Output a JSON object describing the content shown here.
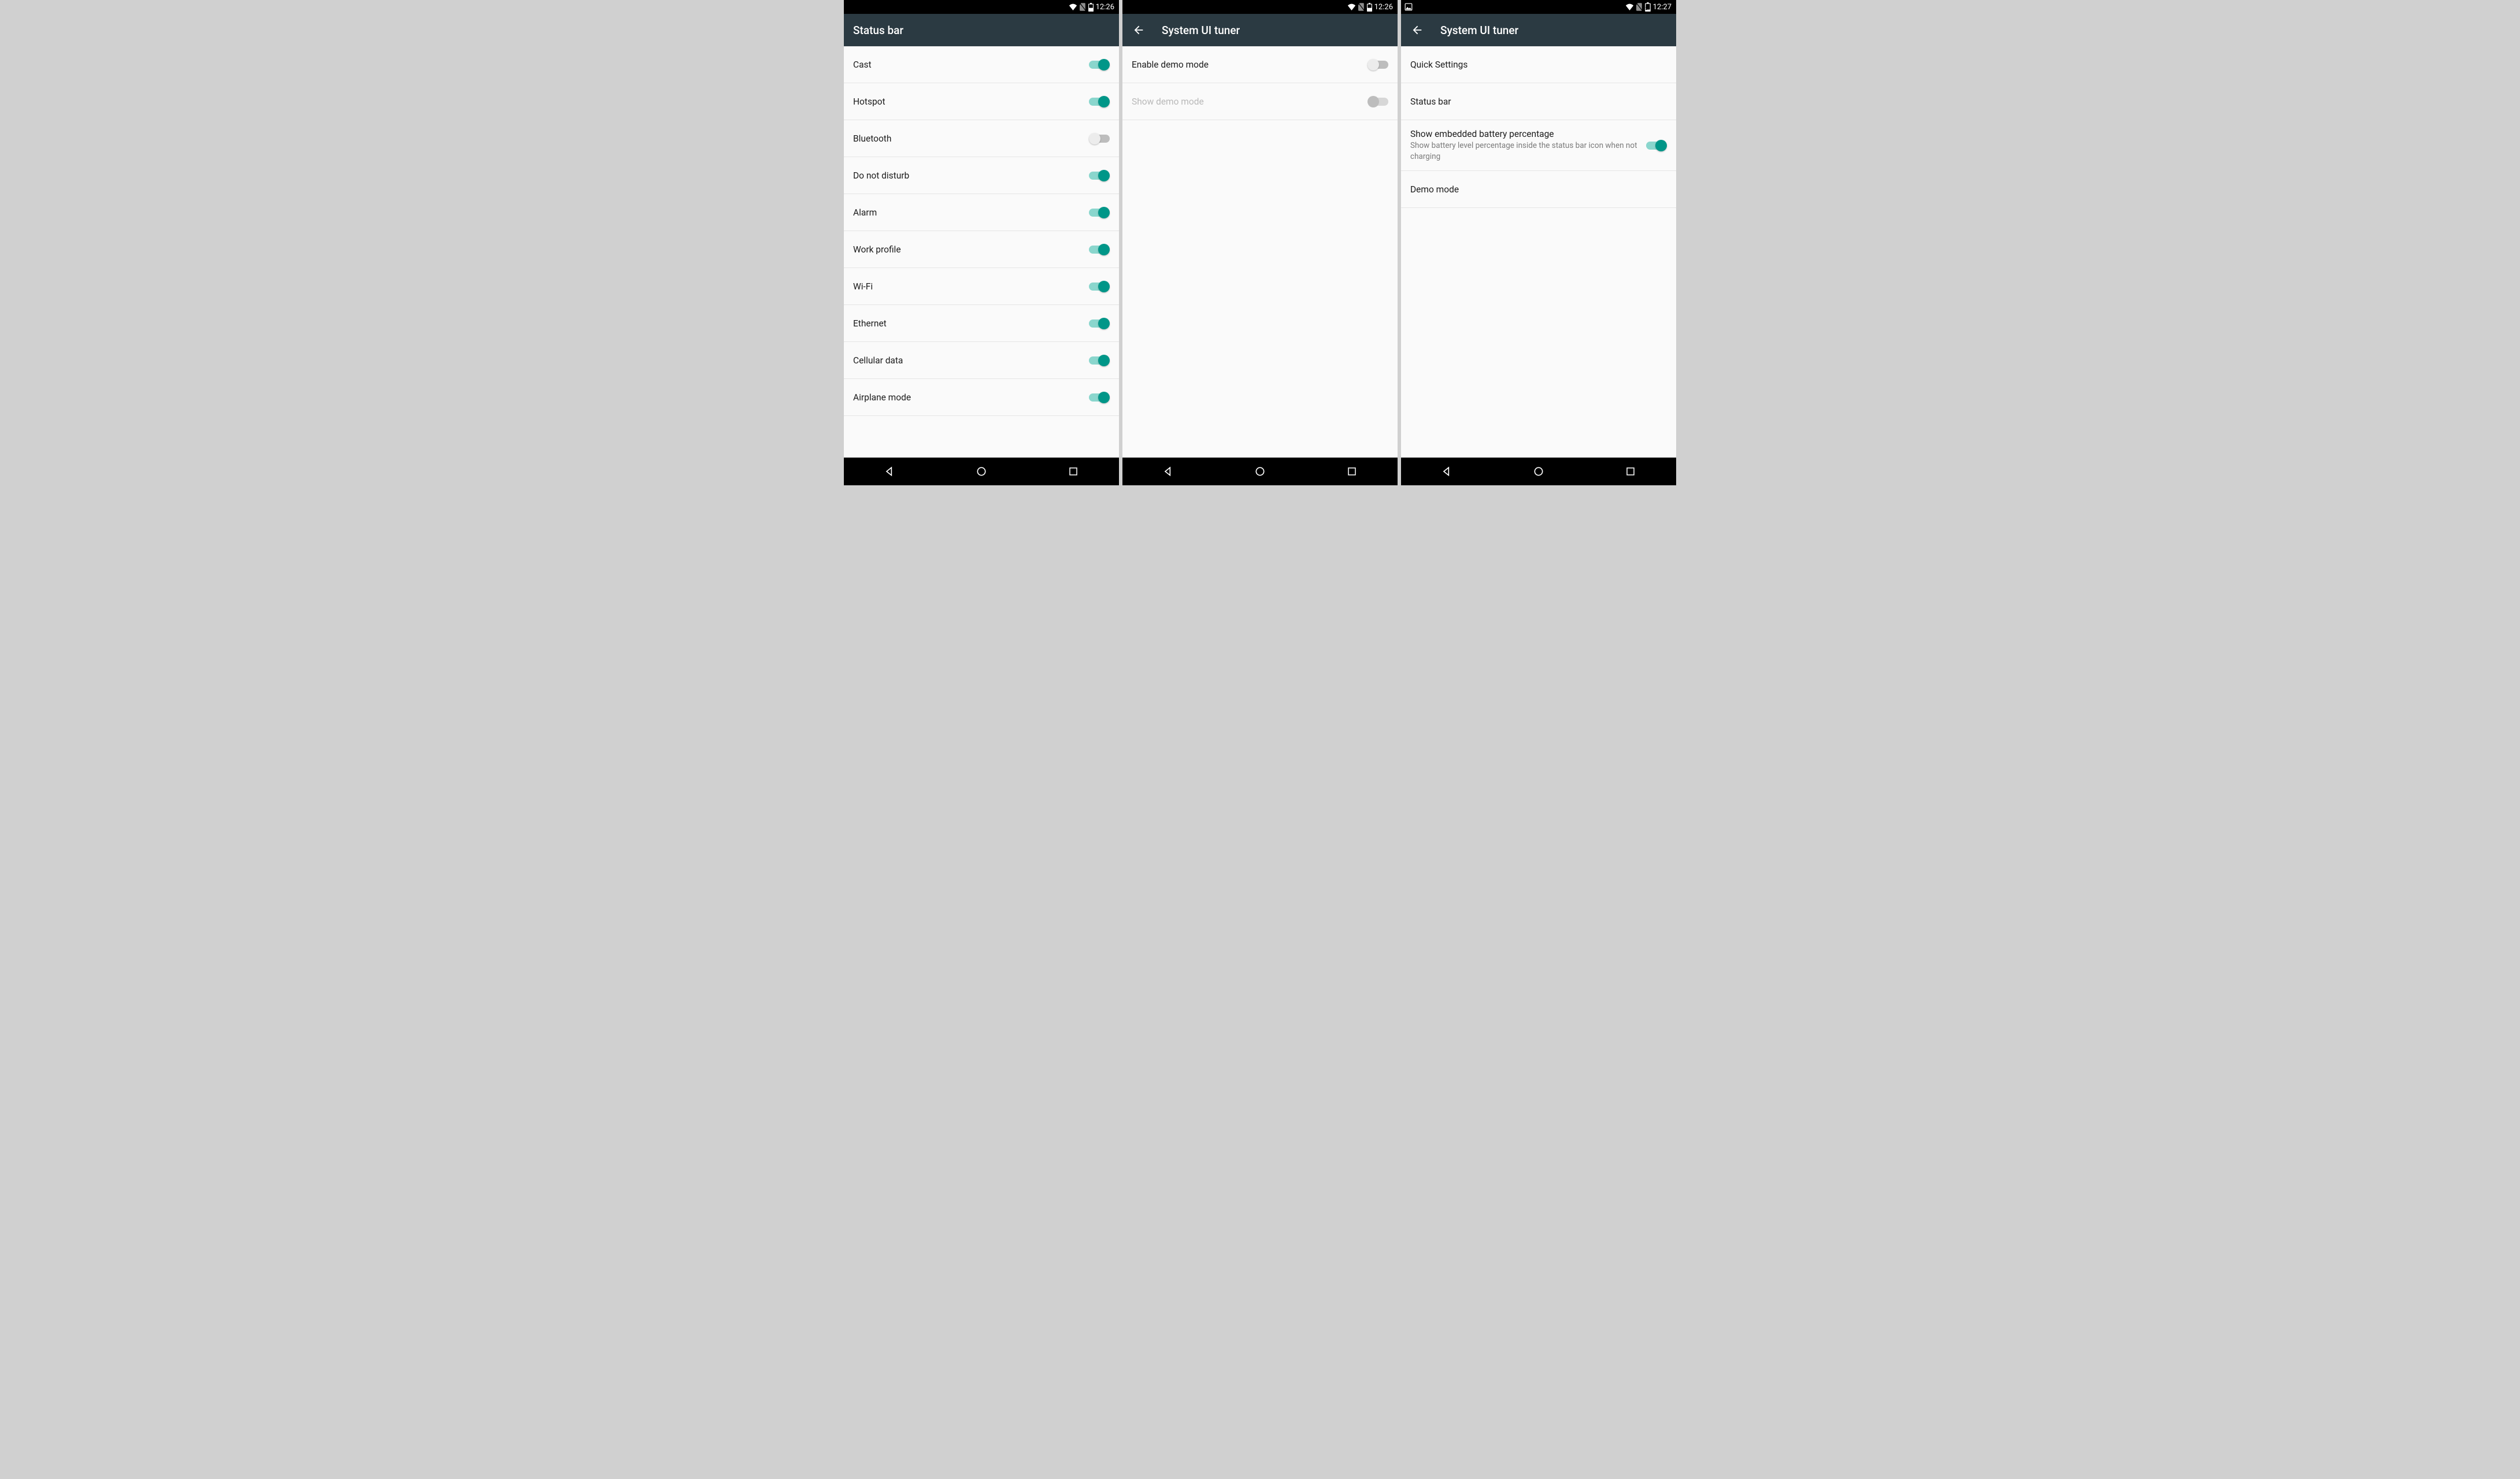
{
  "colors": {
    "accent": "#009688",
    "appbar": "#2b3a42"
  },
  "screens": [
    {
      "statusbar": {
        "time": "12:26",
        "leftIcons": [],
        "rightIcons": [
          "wifi",
          "no-sim",
          "battery"
        ]
      },
      "appbar": {
        "back": false,
        "title": "Status bar"
      },
      "rows": [
        {
          "name": "cast",
          "label": "Cast",
          "switch": "on"
        },
        {
          "name": "hotspot",
          "label": "Hotspot",
          "switch": "on"
        },
        {
          "name": "bluetooth",
          "label": "Bluetooth",
          "switch": "off"
        },
        {
          "name": "dnd",
          "label": "Do not disturb",
          "switch": "on"
        },
        {
          "name": "alarm",
          "label": "Alarm",
          "switch": "on"
        },
        {
          "name": "work-profile",
          "label": "Work profile",
          "switch": "on"
        },
        {
          "name": "wifi",
          "label": "Wi-Fi",
          "switch": "on"
        },
        {
          "name": "ethernet",
          "label": "Ethernet",
          "switch": "on"
        },
        {
          "name": "cellular-data",
          "label": "Cellular data",
          "switch": "on"
        },
        {
          "name": "airplane-mode",
          "label": "Airplane mode",
          "switch": "on"
        }
      ]
    },
    {
      "statusbar": {
        "time": "12:26",
        "leftIcons": [],
        "rightIcons": [
          "wifi",
          "no-sim",
          "battery"
        ]
      },
      "appbar": {
        "back": true,
        "title": "System UI tuner"
      },
      "rows": [
        {
          "name": "enable-demo-mode",
          "label": "Enable demo mode",
          "switch": "off"
        },
        {
          "name": "show-demo-mode",
          "label": "Show demo mode",
          "switch": "off-disabled",
          "disabled": true
        }
      ]
    },
    {
      "statusbar": {
        "time": "12:27",
        "leftIcons": [
          "image"
        ],
        "rightIcons": [
          "wifi",
          "no-sim",
          "battery-21"
        ]
      },
      "appbar": {
        "back": true,
        "title": "System UI tuner"
      },
      "rows": [
        {
          "name": "quick-settings",
          "label": "Quick Settings"
        },
        {
          "name": "status-bar",
          "label": "Status bar"
        },
        {
          "name": "embedded-battery-pct",
          "tall": true,
          "label": "Show embedded battery percentage",
          "sub": "Show battery level percentage inside the status bar icon when not charging",
          "switch": "on"
        },
        {
          "name": "demo-mode",
          "label": "Demo mode"
        }
      ]
    }
  ],
  "batteryBadge": "21"
}
